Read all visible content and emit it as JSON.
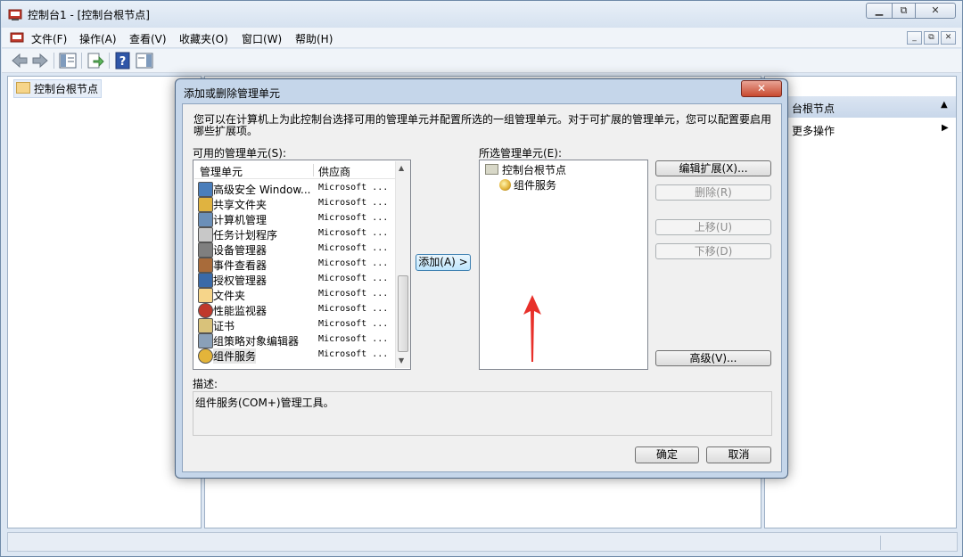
{
  "window": {
    "title": "控制台1 - [控制台根节点]",
    "caption_minimize": "▭",
    "caption_restore": "⧉",
    "caption_close": "✕"
  },
  "menu": {
    "items": [
      "文件(F)",
      "操作(A)",
      "查看(V)",
      "收藏夹(O)",
      "窗口(W)",
      "帮助(H)"
    ]
  },
  "tree": {
    "root_label": "控制台根节点"
  },
  "actions": {
    "title": "台根节点",
    "more": "更多操作"
  },
  "dialog": {
    "title": "添加或删除管理单元",
    "close_glyph": "✕",
    "description": "您可以在计算机上为此控制台选择可用的管理单元并配置所选的一组管理单元。对于可扩展的管理单元，您可以配置要启用哪些扩展项。",
    "available_label": "可用的管理单元(S):",
    "selected_label": "所选管理单元(E):",
    "columns": [
      "管理单元",
      "供应商"
    ],
    "available": [
      {
        "name": "高级安全 Window...",
        "vendor": "Microsoft ..."
      },
      {
        "name": "共享文件夹",
        "vendor": "Microsoft ..."
      },
      {
        "name": "计算机管理",
        "vendor": "Microsoft ..."
      },
      {
        "name": "任务计划程序",
        "vendor": "Microsoft ..."
      },
      {
        "name": "设备管理器",
        "vendor": "Microsoft ..."
      },
      {
        "name": "事件查看器",
        "vendor": "Microsoft ..."
      },
      {
        "name": "授权管理器",
        "vendor": "Microsoft ..."
      },
      {
        "name": "文件夹",
        "vendor": "Microsoft ..."
      },
      {
        "name": "性能监视器",
        "vendor": "Microsoft ..."
      },
      {
        "name": "证书",
        "vendor": "Microsoft ..."
      },
      {
        "name": "组策略对象编辑器",
        "vendor": "Microsoft ..."
      },
      {
        "name": "组件服务",
        "vendor": "Microsoft ..."
      }
    ],
    "add_button": "添加(A) >",
    "selected_root": "控制台根节点",
    "selected_child": "组件服务",
    "buttons": {
      "edit": "编辑扩展(X)...",
      "remove": "删除(R)",
      "up": "上移(U)",
      "down": "下移(D)",
      "advanced": "高级(V)...",
      "ok": "确定",
      "cancel": "取消"
    },
    "desc_label": "描述:",
    "desc_text": "组件服务(COM+)管理工具。"
  },
  "colors": {
    "annotation_arrow": "#e8302a",
    "selection_bg": "#e6e6e6"
  }
}
